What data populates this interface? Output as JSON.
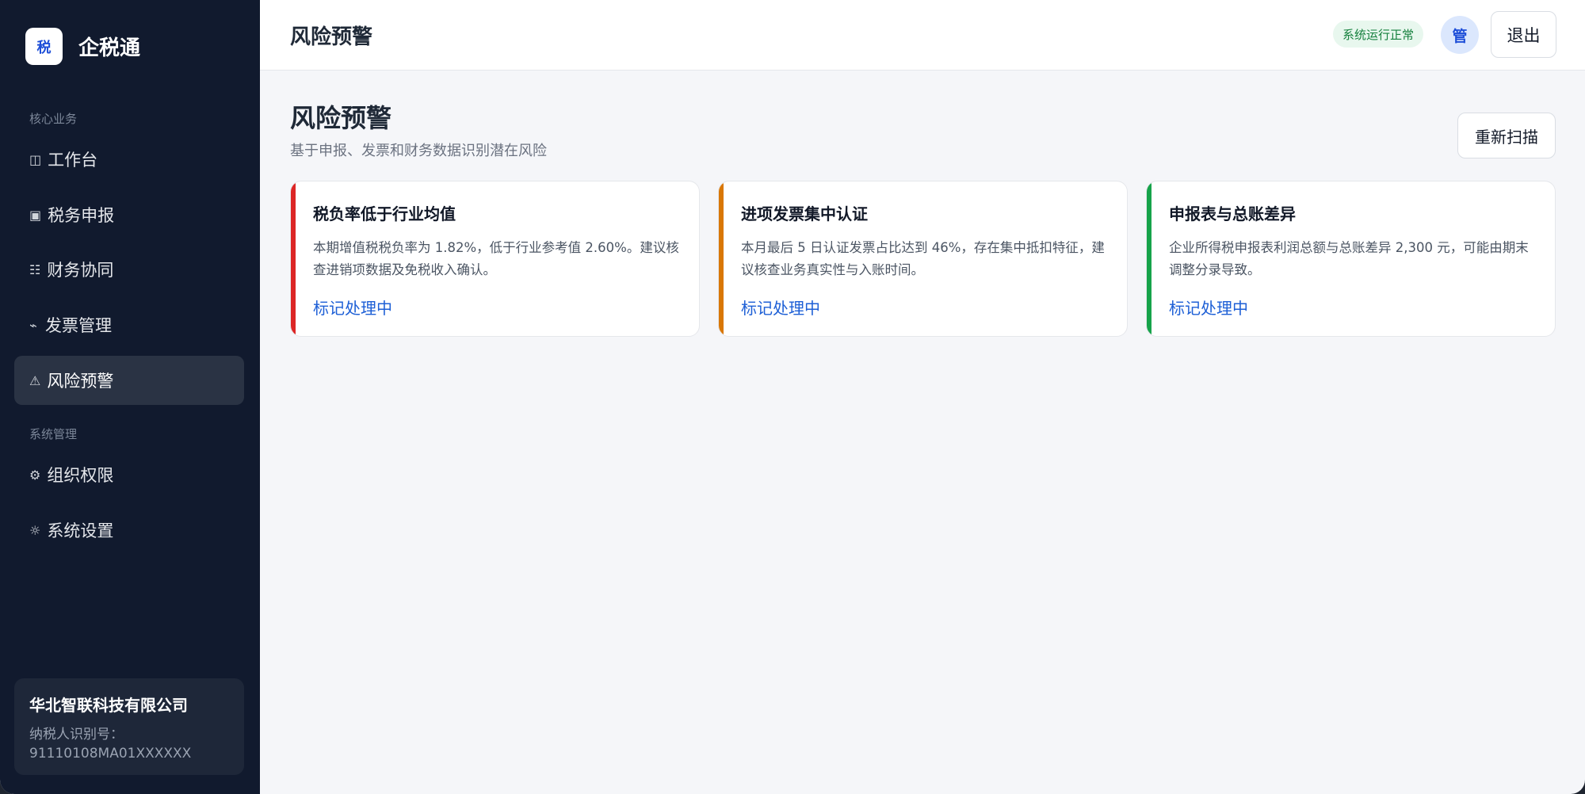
{
  "sidebar": {
    "brand_logo": "税",
    "brand_name": "企税通",
    "section_core": "核心业务",
    "section_system": "系统管理",
    "items": [
      {
        "icon": "◫",
        "label": "工作台"
      },
      {
        "icon": "▣",
        "label": "税务申报"
      },
      {
        "icon": "☷",
        "label": "财务协同"
      },
      {
        "icon": "⌁",
        "label": "发票管理"
      },
      {
        "icon": "⚠",
        "label": "风险预警",
        "active": true
      },
      {
        "icon": "⚙",
        "label": "组织权限"
      },
      {
        "icon": "☼",
        "label": "系统设置"
      }
    ],
    "company": {
      "name": "华北智联科技有限公司",
      "id_label": "纳税人识别号：",
      "id_value": "91110108MA01XXXXXX"
    }
  },
  "topbar": {
    "title": "风险预警",
    "status": "系统运行正常",
    "avatar": "管",
    "logout": "退出"
  },
  "main": {
    "title": "风险预警",
    "subtitle": "基于申报、发票和财务数据识别潜在风险",
    "rescan": "重新扫描",
    "cards": [
      {
        "title": "税负率低于行业均值",
        "desc": "本期增值税税负率为 1.82%，低于行业参考值 2.60%。建议核查进销项数据及免税收入确认。",
        "action": "标记处理中",
        "accent": "#dc2626"
      },
      {
        "title": "进项发票集中认证",
        "desc": "本月最后 5 日认证发票占比达到 46%，存在集中抵扣特征，建议核查业务真实性与入账时间。",
        "action": "标记处理中",
        "accent": "#d97706"
      },
      {
        "title": "申报表与总账差异",
        "desc": "企业所得税申报表利润总额与总账差异 2,300 元，可能由期末调整分录导致。",
        "action": "标记处理中",
        "accent": "#16a34a"
      }
    ]
  }
}
